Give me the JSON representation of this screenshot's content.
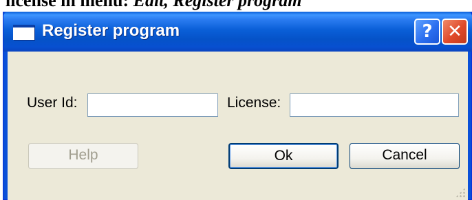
{
  "caption": {
    "prefix": "license in menu: ",
    "emphasis": "Edit, Register program"
  },
  "window": {
    "title": "Register program",
    "help_caption_glyph": "?",
    "close_caption_glyph": "✕"
  },
  "form": {
    "user_id_label": "User Id:",
    "user_id_value": "",
    "license_label": "License:",
    "license_value": ""
  },
  "buttons": {
    "help": "Help",
    "ok": "Ok",
    "cancel": "Cancel"
  }
}
